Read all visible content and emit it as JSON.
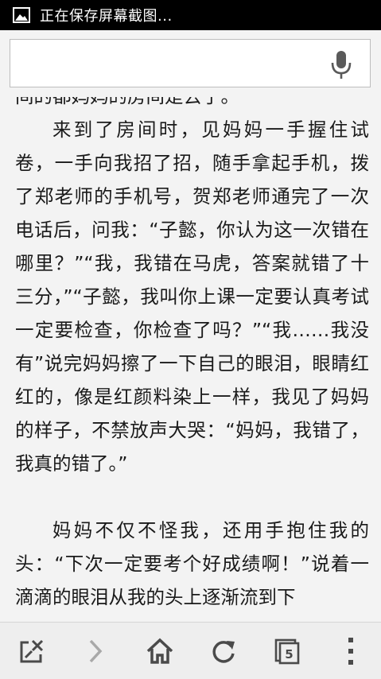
{
  "status_bar": {
    "icon": "image-icon",
    "text": "正在保存屏幕截图..."
  },
  "search": {
    "value": "",
    "placeholder": "",
    "mic_icon": "microphone-icon"
  },
  "article": {
    "cut_line": "间的都妈妈的房间是去了。",
    "paragraphs": [
      "来到了房间时，见妈妈一手握住试卷，一手向我招了招，随手拿起手机，拨了郑老师的手机号，贺郑老师通完了一次电话后，问我：“子懿，你认为这一次错在哪里？”“我，我错在马虎，答案就错了十三分，”“子懿，我叫你上课一定要认真考试一定要检查，你检查了吗？”“我……我没有”说完妈妈擦了一下自己的眼泪，眼睛红红的，像是红颜料染上一样，我见了妈妈的样子，不禁放声大哭：“妈妈，我错了，我真的错了。”",
      "妈妈不仅不怪我，还用手抱住我的头：“下次一定要考个好成绩啊！”说着一滴滴的眼泪从我的头上逐渐流到下"
    ]
  },
  "toolbar": {
    "buttons": [
      {
        "name": "close-tab-button",
        "icon": "close-tab-icon"
      },
      {
        "name": "forward-button",
        "icon": "chevron-right-icon"
      },
      {
        "name": "home-button",
        "icon": "home-icon"
      },
      {
        "name": "refresh-button",
        "icon": "refresh-icon"
      },
      {
        "name": "tabs-button",
        "icon": "tabs-icon",
        "count": "5"
      },
      {
        "name": "menu-button",
        "icon": "overflow-menu-icon"
      }
    ]
  },
  "colors": {
    "status_bar_bg": "#000000",
    "page_bg": "#f3f3f3",
    "text": "#1a1a1a",
    "icon": "#4a4a4a",
    "icon_disabled": "#a8a8a8"
  }
}
